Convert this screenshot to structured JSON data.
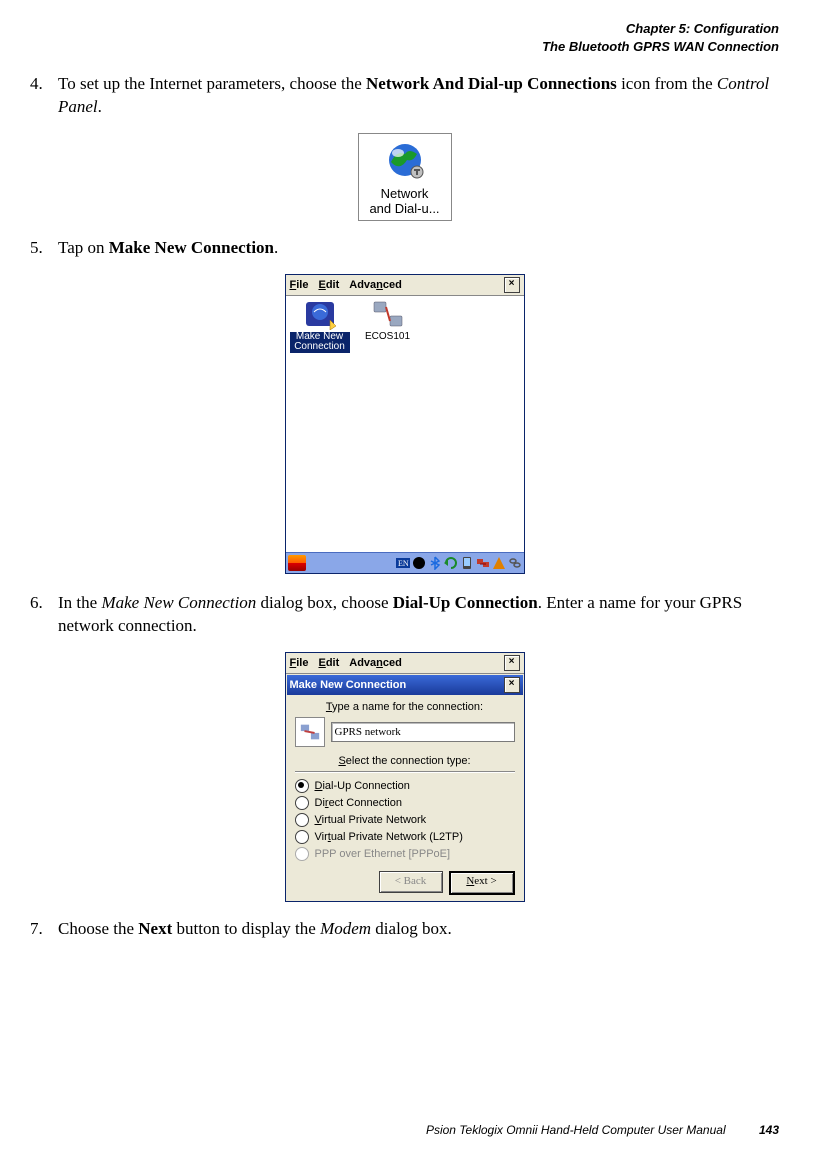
{
  "header": {
    "chapter": "Chapter 5:  Configuration",
    "section": "The Bluetooth GPRS WAN Connection"
  },
  "steps": {
    "s4": {
      "num": "4.",
      "t1": "To set up the Internet parameters, choose the ",
      "b1": "Network And Dial-up Connections",
      "t2": " icon from the ",
      "i1": "Control Panel",
      "t3": "."
    },
    "s5": {
      "num": "5.",
      "t1": "Tap on ",
      "b1": "Make New Connection",
      "t2": "."
    },
    "s6": {
      "num": "6.",
      "t1": "In the ",
      "i1": "Make New Connection",
      "t2": " dialog box, choose ",
      "b1": "Dial-Up Connection",
      "t3": ". Enter a name for your GPRS network connection."
    },
    "s7": {
      "num": "7.",
      "t1": "Choose the ",
      "b1": "Next",
      "t2": " button to display the ",
      "i1": "Modem",
      "t3": " dialog box."
    }
  },
  "fig1": {
    "line1": "Network",
    "line2": "and Dial-u..."
  },
  "fig2": {
    "menu": {
      "file": "File",
      "edit": "Edit",
      "advanced": "Advanced"
    },
    "items": {
      "make_new": "Make New Connection",
      "ecos": "ECOS101"
    }
  },
  "fig3": {
    "menu": {
      "file": "File",
      "edit": "Edit",
      "advanced": "Advanced"
    },
    "title": "Make New Connection",
    "prompt1": "Type a name for the connection:",
    "input": "GPRS network",
    "prompt2": "Select the connection type:",
    "options": {
      "o1": "Dial-Up Connection",
      "o2": "Direct Connection",
      "o3": "Virtual Private Network",
      "o4": "Virtual Private Network (L2TP)",
      "o5": "PPP over Ethernet [PPPoE]"
    },
    "buttons": {
      "back": "< Back",
      "next": "Next >"
    }
  },
  "footer": {
    "text": "Psion Teklogix Omnii Hand-Held Computer User Manual",
    "page": "143"
  }
}
